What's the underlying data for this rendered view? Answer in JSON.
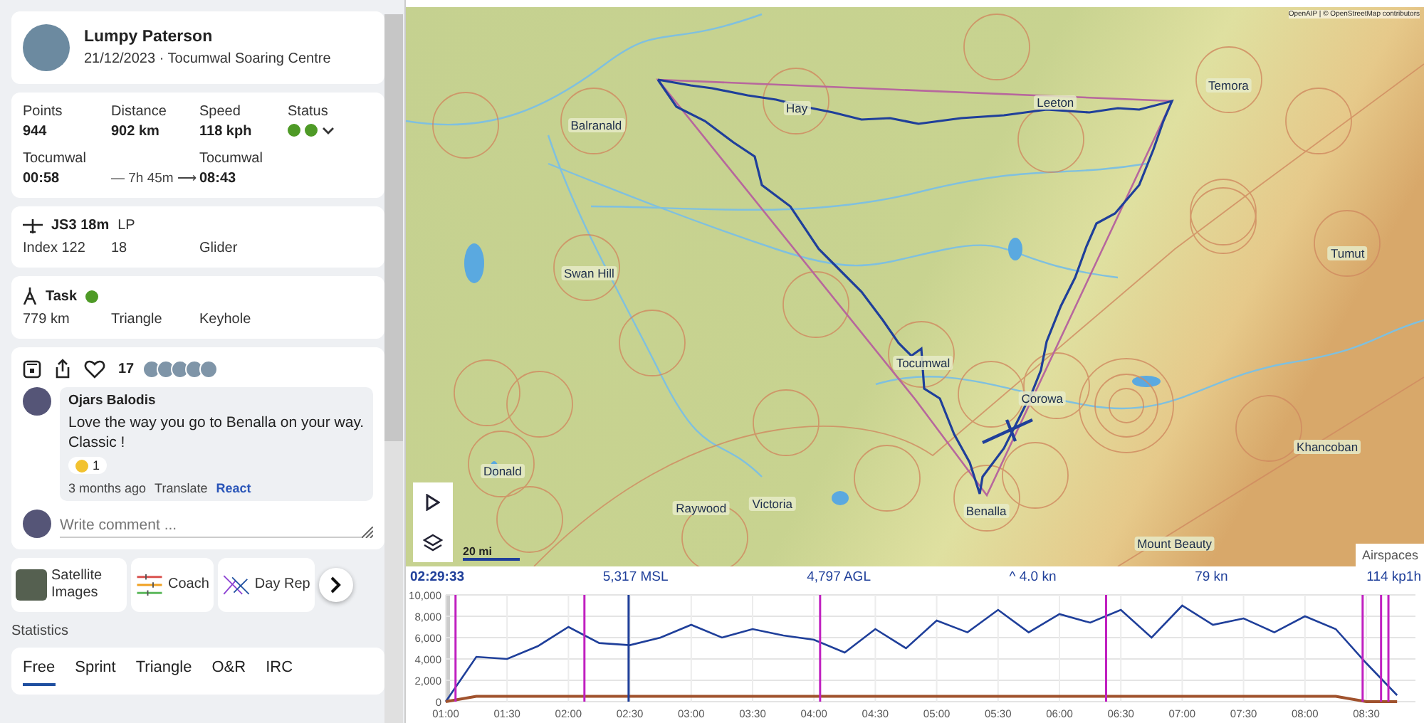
{
  "pilot": {
    "name": "Lumpy Paterson",
    "subtitle": "21/12/2023 · Tocumwal Soaring Centre"
  },
  "summary": {
    "stats": [
      {
        "label": "Points",
        "value": "944"
      },
      {
        "label": "Distance",
        "value": "902 km"
      },
      {
        "label": "Speed",
        "value": "118 kph"
      }
    ],
    "status_label": "Status",
    "takeoff": {
      "place": "Tocumwal",
      "time": "00:58"
    },
    "duration": "— 7h 45m ⟶",
    "landing": {
      "place": "Tocumwal",
      "time": "08:43"
    }
  },
  "glider": {
    "model": "JS3 18m",
    "reg": "LP",
    "index": "Index 122",
    "class": "18",
    "type": "Glider"
  },
  "task": {
    "title": "Task",
    "distance": "779 km",
    "shape": "Triangle",
    "sector": "Keyhole"
  },
  "social": {
    "likes": "17",
    "comment": {
      "author": "Ojars Balodis",
      "text": "Love the way you go to Benalla on your way. Classic !",
      "reaction_count": "1",
      "age": "3 months ago",
      "translate": "Translate",
      "react": "React"
    },
    "comment_placeholder": "Write comment ..."
  },
  "tools": [
    {
      "kind": "satellite",
      "label": "Satellite Images"
    },
    {
      "kind": "coach",
      "label": "Coach"
    },
    {
      "kind": "day",
      "label": "Day Rep"
    }
  ],
  "statistics": {
    "title": "Statistics",
    "tabs": [
      {
        "label": "Free",
        "selected": true
      },
      {
        "label": "Sprint",
        "selected": false
      },
      {
        "label": "Triangle",
        "selected": false
      },
      {
        "label": "O&R",
        "selected": false
      },
      {
        "label": "IRC",
        "selected": false
      }
    ]
  },
  "map": {
    "attribution": "OpenAIP | © OpenStreetMap contributors",
    "scale": "20 mi",
    "airspaces_button": "Airspaces",
    "places": [
      {
        "name": "Balranald"
      },
      {
        "name": "Hay"
      },
      {
        "name": "Leeton"
      },
      {
        "name": "Temora"
      },
      {
        "name": "Swan Hill"
      },
      {
        "name": "Tumut"
      },
      {
        "name": "Tocumwal"
      },
      {
        "name": "Corowa"
      },
      {
        "name": "Khancoban"
      },
      {
        "name": "Donald"
      },
      {
        "name": "Raywood"
      },
      {
        "name": "Victoria"
      },
      {
        "name": "Benalla"
      },
      {
        "name": "Mount Beauty"
      }
    ]
  },
  "readout": {
    "time": "02:29:33",
    "msl": "5,317 MSL",
    "agl": "4,797 AGL",
    "climb": "^ 4.0 kn",
    "speed": "79 kn",
    "ld": "114 kp1h"
  },
  "chart_data": {
    "type": "line",
    "x": [
      1,
      1.25,
      1.5,
      1.75,
      2,
      2.25,
      2.5,
      2.75,
      3,
      3.25,
      3.5,
      3.75,
      4,
      4.25,
      4.5,
      4.75,
      5,
      5.25,
      5.5,
      5.75,
      6,
      6.25,
      6.5,
      6.75,
      7,
      7.25,
      7.5,
      7.75,
      8,
      8.25,
      8.5,
      8.75
    ],
    "series": [
      {
        "color": "#1f3f9a",
        "values": [
          0,
          4200,
          4000,
          5200,
          7000,
          5500,
          5300,
          6000,
          7200,
          6000,
          6800,
          6200,
          5800,
          4600,
          6800,
          5000,
          7600,
          6500,
          8600,
          6500,
          8200,
          7400,
          8600,
          6000,
          9000,
          7200,
          7800,
          6500,
          8000,
          6800,
          3600,
          600
        ]
      },
      {
        "color": "#a0522d",
        "values": [
          0,
          500,
          500,
          500,
          500,
          500,
          500,
          500,
          500,
          500,
          500,
          500,
          500,
          500,
          500,
          500,
          500,
          500,
          500,
          500,
          500,
          500,
          500,
          500,
          500,
          500,
          500,
          500,
          500,
          500,
          0,
          0
        ]
      }
    ],
    "grid": true,
    "xlim": [
      1,
      8.9
    ],
    "ylim": [
      0,
      10000
    ],
    "xticks": [
      {
        "value": 1,
        "label": "01:00"
      },
      {
        "value": 1.5,
        "label": "01:30"
      },
      {
        "value": 2,
        "label": "02:00"
      },
      {
        "value": 2.5,
        "label": "02:30"
      },
      {
        "value": 3,
        "label": "03:00"
      },
      {
        "value": 3.5,
        "label": "03:30"
      },
      {
        "value": 4,
        "label": "04:00"
      },
      {
        "value": 4.5,
        "label": "04:30"
      },
      {
        "value": 5,
        "label": "05:00"
      },
      {
        "value": 5.5,
        "label": "05:30"
      },
      {
        "value": 6,
        "label": "06:00"
      },
      {
        "value": 6.5,
        "label": "06:30"
      },
      {
        "value": 7,
        "label": "07:00"
      },
      {
        "value": 7.5,
        "label": "07:30"
      },
      {
        "value": 8,
        "label": "08:00"
      },
      {
        "value": 8.5,
        "label": "08:30"
      }
    ],
    "yticks": [
      {
        "value": 0,
        "label": "0"
      },
      {
        "value": 2000,
        "label": "2,000"
      },
      {
        "value": 4000,
        "label": "4,000"
      },
      {
        "value": 6000,
        "label": "6,000"
      },
      {
        "value": 8000,
        "label": "8,000"
      },
      {
        "value": 10000,
        "label": "10,000"
      }
    ],
    "bands": [
      {
        "axis": "x",
        "from": 1,
        "to": 1.035,
        "color": "#cccccc"
      }
    ],
    "ref_lines": [
      {
        "axis": "x",
        "value": 1.08,
        "color": "#c020c0"
      },
      {
        "axis": "x",
        "value": 2.13,
        "color": "#c020c0"
      },
      {
        "axis": "x",
        "value": 2.49,
        "color": "#1f3f9a"
      },
      {
        "axis": "x",
        "value": 4.05,
        "color": "#c020c0"
      },
      {
        "axis": "x",
        "value": 6.38,
        "color": "#c020c0"
      },
      {
        "axis": "x",
        "value": 8.47,
        "color": "#c020c0"
      },
      {
        "axis": "x",
        "value": 8.62,
        "color": "#c020c0"
      },
      {
        "axis": "x",
        "value": 8.68,
        "color": "#c020c0"
      }
    ]
  }
}
